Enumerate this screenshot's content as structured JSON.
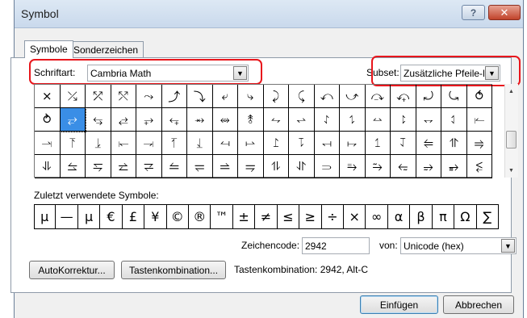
{
  "window": {
    "title": "Symbol",
    "help_label": "?",
    "close_label": "✕"
  },
  "tabs": [
    {
      "label": "Symbole",
      "active": true
    },
    {
      "label": "Sonderzeichen",
      "active": false
    }
  ],
  "font": {
    "label": "Schriftart:",
    "value": "Cambria Math"
  },
  "subset": {
    "label": "Subset:",
    "value": "Zusätzliche Pfeile-B"
  },
  "symbols": [
    "⨯",
    "⤰",
    "⤱",
    "⤲",
    "⤳",
    "⤴",
    "⤵",
    "⤶",
    "⤷",
    "⤸",
    "⤹",
    "⤺",
    "⤻",
    "⤼",
    "⤽",
    "⤾",
    "⤿",
    "⥀",
    "⥁",
    "⥂",
    "⥃",
    "⥄",
    "⥅",
    "⥆",
    "⥇",
    "⥈",
    "⥉",
    "⥊",
    "⥋",
    "⥌",
    "⥍",
    "⥎",
    "⥏",
    "⥐",
    "⥑",
    "⥒",
    "⥓",
    "⥔",
    "⥕",
    "⥖",
    "⥗",
    "⥘",
    "⥙",
    "⥚",
    "⥛",
    "⥜",
    "⥝",
    "⥞",
    "⥟",
    "⥠",
    "⥡",
    "⥢",
    "⥣",
    "⥤",
    "⥥",
    "⥦",
    "⥧",
    "⥨",
    "⥩",
    "⥪",
    "⥫",
    "⥬",
    "⥭",
    "⥮",
    "⥯",
    "⥰",
    "⥱",
    "⥲",
    "⥳",
    "⥴",
    "⥵",
    "⥶"
  ],
  "selected_index": 19,
  "recent": {
    "label": "Zuletzt verwendete Symbole:",
    "items": [
      "μ",
      "—",
      "μ",
      "€",
      "£",
      "¥",
      "©",
      "®",
      "™",
      "±",
      "≠",
      "≤",
      "≥",
      "÷",
      "×",
      "∞",
      "α",
      "β",
      "π",
      "Ω",
      "∑"
    ]
  },
  "charcode": {
    "label": "Zeichencode:",
    "value": "2942"
  },
  "from": {
    "label": "von:",
    "value": "Unicode (hex)"
  },
  "buttons": {
    "autocorrect": "AutoKorrektur...",
    "shortcut": "Tastenkombination...",
    "insert": "Einfügen",
    "cancel": "Abbrechen"
  },
  "shortcut_info": "Tastenkombination: 2942, Alt-C"
}
